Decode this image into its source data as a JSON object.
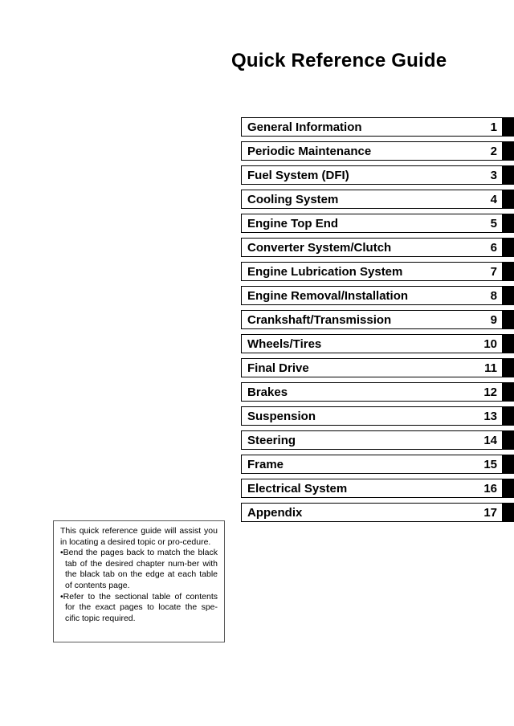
{
  "document": {
    "title": "Quick Reference Guide"
  },
  "chapters": [
    {
      "label": "General Information",
      "number": "1"
    },
    {
      "label": "Periodic Maintenance",
      "number": "2"
    },
    {
      "label": "Fuel System (DFI)",
      "number": "3"
    },
    {
      "label": "Cooling System",
      "number": "4"
    },
    {
      "label": "Engine Top End",
      "number": "5"
    },
    {
      "label": "Converter System/Clutch",
      "number": "6"
    },
    {
      "label": "Engine Lubrication System",
      "number": "7"
    },
    {
      "label": "Engine Removal/Installation",
      "number": "8"
    },
    {
      "label": "Crankshaft/Transmission",
      "number": "9"
    },
    {
      "label": "Wheels/Tires",
      "number": "10"
    },
    {
      "label": "Final Drive",
      "number": "11"
    },
    {
      "label": "Brakes",
      "number": "12"
    },
    {
      "label": "Suspension",
      "number": "13"
    },
    {
      "label": "Steering",
      "number": "14"
    },
    {
      "label": "Frame",
      "number": "15"
    },
    {
      "label": "Electrical System",
      "number": "16"
    },
    {
      "label": "Appendix",
      "number": "17"
    }
  ],
  "info_box": {
    "intro": "This quick reference guide will assist you in locating a desired topic or pro-cedure.",
    "bullets": [
      "•Bend the pages back to match the black tab of the desired chapter num-ber with the black tab on the edge at each table of contents page.",
      "•Refer to the sectional table of contents for the exact pages to locate the spe-cific topic required."
    ]
  },
  "colors": {
    "page_background": "#ffffff",
    "text": "#000000",
    "tab_black": "#000000",
    "info_box_border": "#5a5a5a"
  }
}
